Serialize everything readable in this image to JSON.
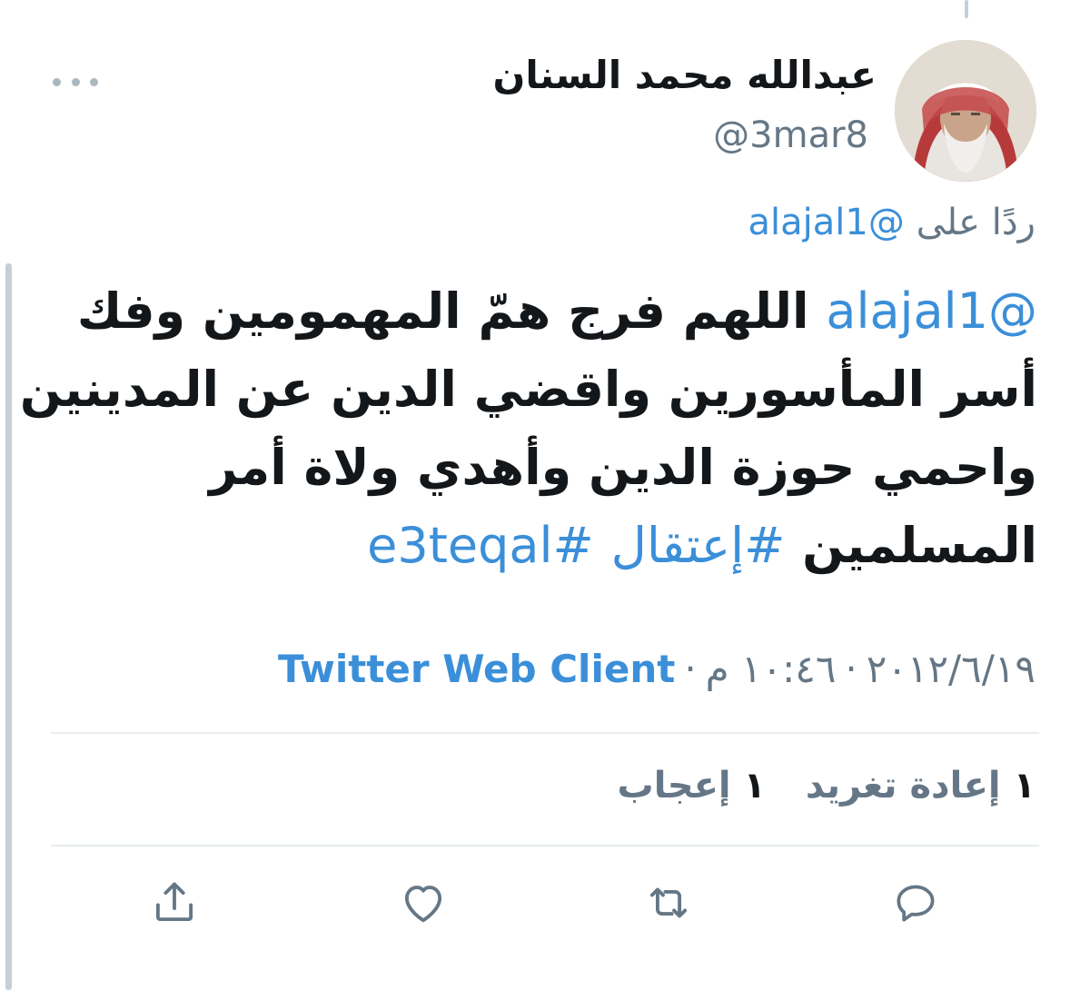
{
  "tweet": {
    "display_name": "عبدالله محمد السنان",
    "handle": "@3mar8",
    "reply_prefix": "ردًا على",
    "reply_to": "@alajal1",
    "mention": "@alajal1",
    "text_line1": " اللهم فرج همّ المهمومين وفك",
    "text_line2": "أسر المأسورين واقضي الدين عن المدينين",
    "text_line3": "واحمي حوزة الدين وأهدي ولاة أمر",
    "text_line4_prefix": "المسلمين ",
    "hashtag1": "#إعتقال",
    "hashtag2": "#e3teqal",
    "date": "٢٠١٢/٦/١٩",
    "time": "١٠:٤٦ م",
    "separator": "·",
    "source": "Twitter Web Client"
  },
  "stats": {
    "retweets_count": "١",
    "retweets_label": "إعادة تغريد",
    "likes_count": "١",
    "likes_label": "إعجاب"
  },
  "icons": {
    "more": "more-icon",
    "reply": "reply-icon",
    "retweet": "retweet-icon",
    "like": "heart-icon",
    "share": "share-icon"
  },
  "colors": {
    "link": "#3b8fd9",
    "secondary_text": "#657786",
    "icon": "#657786",
    "divider": "#e6ecf0"
  }
}
